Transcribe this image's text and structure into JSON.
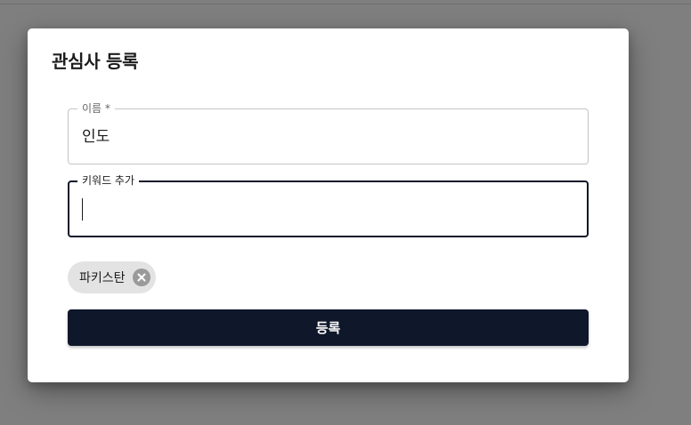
{
  "dialog": {
    "title": "관심사 등록",
    "name_field": {
      "label": "이름 *",
      "value": "인도"
    },
    "keyword_field": {
      "label": "키워드 추가",
      "value": ""
    },
    "chips": [
      {
        "label": "파키스탄",
        "delete_icon": "close-circle-icon"
      }
    ],
    "submit_label": "등록"
  },
  "colors": {
    "backdrop": "#7f7f7f",
    "primary": "#0f172a",
    "chip_bg": "#e3e3e3"
  }
}
